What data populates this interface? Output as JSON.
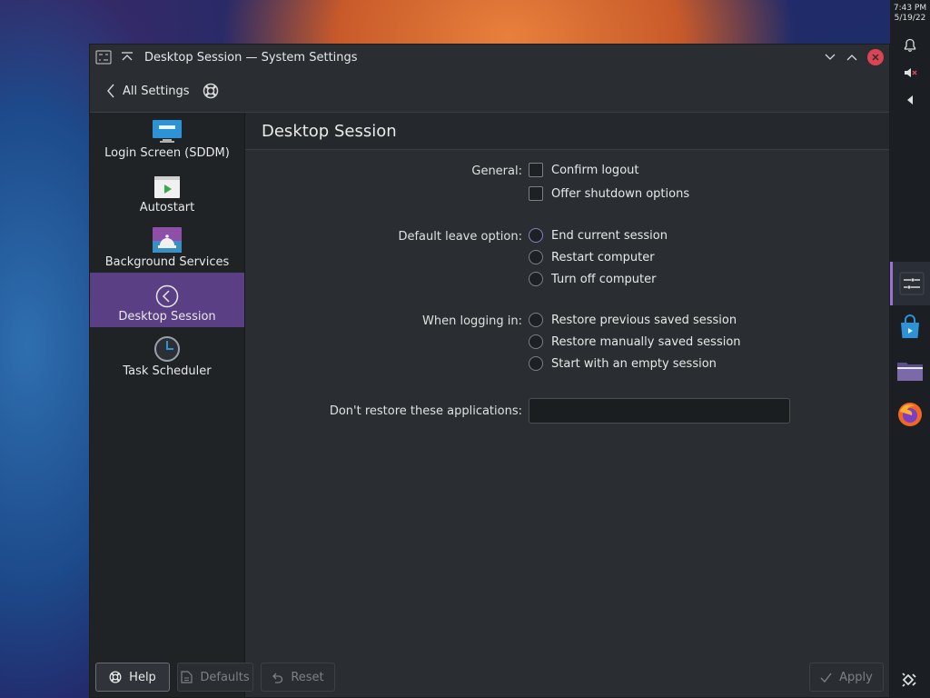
{
  "panel": {
    "time": "7:43 PM",
    "date": "5/19/22"
  },
  "window": {
    "title": "Desktop Session — System Settings"
  },
  "toolbar": {
    "back_label": "All Settings"
  },
  "sidebar": {
    "items": [
      {
        "label": "Login Screen (SDDM)",
        "icon": "monitor-icon"
      },
      {
        "label": "Autostart",
        "icon": "play-icon"
      },
      {
        "label": "Background Services",
        "icon": "bell-service-icon"
      },
      {
        "label": "Desktop Session",
        "icon": "session-back-icon",
        "selected": true
      },
      {
        "label": "Task Scheduler",
        "icon": "clock-icon"
      }
    ]
  },
  "content": {
    "heading": "Desktop Session",
    "general": {
      "label": "General:",
      "confirm_logout": "Confirm logout",
      "offer_shutdown": "Offer shutdown options"
    },
    "leave": {
      "label": "Default leave option:",
      "options": [
        "End current session",
        "Restart computer",
        "Turn off computer"
      ]
    },
    "login": {
      "label": "When logging in:",
      "options": [
        "Restore previous saved session",
        "Restore manually saved session",
        "Start with an empty session"
      ]
    },
    "exclude": {
      "label": "Don't restore these applications:",
      "value": ""
    }
  },
  "footer": {
    "help": "Help",
    "defaults": "Defaults",
    "reset": "Reset",
    "apply": "Apply"
  },
  "colors": {
    "selection": "#5b3f85",
    "close": "#da4453"
  }
}
